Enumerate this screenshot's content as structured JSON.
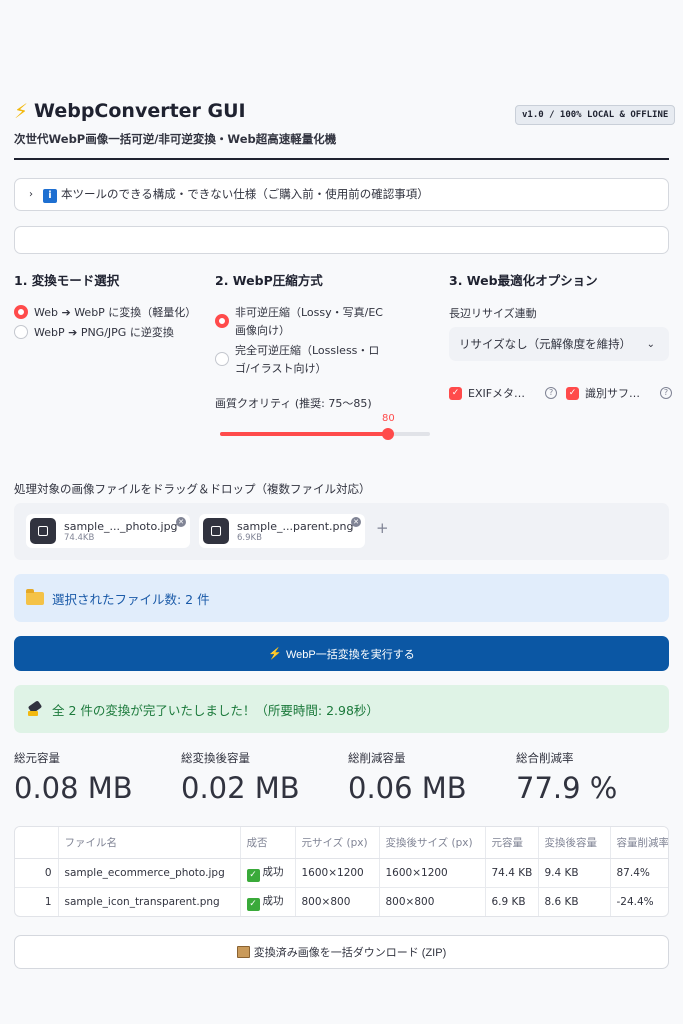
{
  "header": {
    "title": "WebpConverter GUI",
    "version": "v1.0 / 100% LOCAL & OFFLINE",
    "subtitle": "次世代WebP画像一括可逆/非可逆変換・Web超高速軽量化機"
  },
  "expander": {
    "icon_text": "i",
    "label": "本ツールのできる構成・できない仕様（ご購入前・使用前の確認事項）"
  },
  "mode": {
    "heading": "1. 変換モード選択",
    "options": [
      "Web ➔ WebP に変換（軽量化）",
      "WebP ➔ PNG/JPG に逆変換"
    ],
    "selected": 0
  },
  "compression": {
    "heading": "2. WebP圧縮方式",
    "options": [
      "非可逆圧縮（Lossy・写真/EC画像向け）",
      "完全可逆圧縮（Lossless・ロゴ/イラスト向け）"
    ],
    "selected": 0,
    "quality_label": "画質クオリティ (推奨: 75〜85)",
    "quality_value": 80,
    "quality_min": 0,
    "quality_max": 100
  },
  "web_opt": {
    "heading": "3. Web最適化オプション",
    "resize_label": "長辺リサイズ連動",
    "resize_value": "リサイズなし（元解像度を維持）",
    "checks": [
      {
        "label": "EXIFメタ…",
        "checked": true
      },
      {
        "label": "識別サフ…",
        "checked": true
      }
    ]
  },
  "uploader": {
    "label": "処理対象の画像ファイルをドラッグ＆ドロップ（複数ファイル対応）",
    "files": [
      {
        "name": "sample_..._photo.jpg",
        "size": "74.4KB"
      },
      {
        "name": "sample_...parent.png",
        "size": "6.9KB"
      }
    ],
    "plus": "+"
  },
  "info": {
    "text": "選択されたファイル数: 2 件"
  },
  "convert_button": "WebP一括変換を実行する",
  "success": {
    "text": "全 2 件の変換が完了いたしました！（所要時間: 2.98秒）"
  },
  "metrics": [
    {
      "label": "総元容量",
      "value": "0.08 MB"
    },
    {
      "label": "総変換後容量",
      "value": "0.02 MB"
    },
    {
      "label": "総削減容量",
      "value": "0.06 MB"
    },
    {
      "label": "総合削減率",
      "value": "77.9 %"
    }
  ],
  "table": {
    "headers": [
      "",
      "ファイル名",
      "成否",
      "元サイズ (px)",
      "変換後サイズ (px)",
      "元容量",
      "変換後容量",
      "容量削減率"
    ],
    "rows": [
      [
        "0",
        "sample_ecommerce_photo.jpg",
        "成功",
        "1600×1200",
        "1600×1200",
        "74.4 KB",
        "9.4 KB",
        "87.4%"
      ],
      [
        "1",
        "sample_icon_transparent.png",
        "成功",
        "800×800",
        "800×800",
        "6.9 KB",
        "8.6 KB",
        "-24.4%"
      ]
    ]
  },
  "download_button": "変換済み画像を一括ダウンロード (ZIP)",
  "colors": {
    "accent": "#ff4b4b",
    "primary": "#0b57a4",
    "info_bg": "#e1edfb",
    "success_bg": "#dff3e6"
  }
}
